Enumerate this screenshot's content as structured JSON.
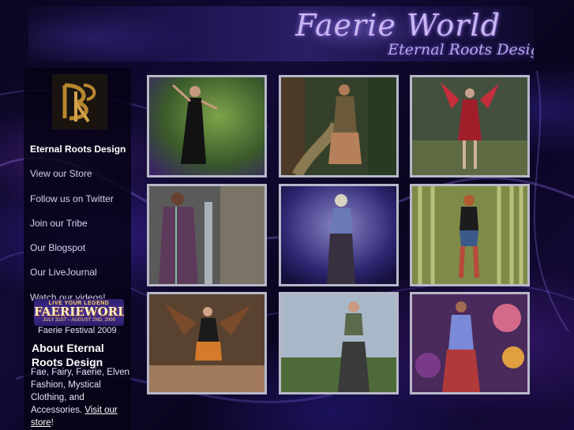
{
  "banner": {
    "title": "Faerie World",
    "subtitle": "Eternal Roots Design"
  },
  "logo": {
    "icon": "erd-monogram-logo"
  },
  "nav": {
    "items": [
      {
        "label": "Eternal Roots Design",
        "active": true
      },
      {
        "label": "View our Store"
      },
      {
        "label": "Follow us on Twitter"
      },
      {
        "label": "Join our Tribe"
      },
      {
        "label": "Our Blogspot"
      },
      {
        "label": "Our LiveJournal"
      },
      {
        "label": "Watch our videos!"
      }
    ]
  },
  "promo": {
    "badge_top": "LIVE YOUR LEGEND",
    "badge_main": "FAERIEWORLDS",
    "badge_dates": "JULY 31ST – AUGUST 2ND, 2009",
    "caption": "Faerie Festival 2009"
  },
  "about": {
    "title": "About Eternal Roots Design",
    "text": "Fae, Fairy, Faerie, Elven Fashion, Mystical Clothing, and Accessories. ",
    "link_label": "Visit our store",
    "trailing": "!"
  },
  "gallery": {
    "images": [
      {
        "alt": "Fairy in black dress in green forest"
      },
      {
        "alt": "Woodland fairy in leather outfit on path"
      },
      {
        "alt": "Red winged fairy in forest"
      },
      {
        "alt": "Elf in purple embroidered coat by waterfall"
      },
      {
        "alt": "Fairy with blonde hair and blue top"
      },
      {
        "alt": "Fairy in bamboo forest"
      },
      {
        "alt": "Winged fairy on rocks"
      },
      {
        "alt": "Fairy with long skirt in meadow"
      },
      {
        "alt": "Fairy in purple top with colorful background"
      }
    ]
  },
  "colors": {
    "background": "#070314",
    "accent": "#c9b6f2",
    "frame": "#b6b8c8"
  }
}
